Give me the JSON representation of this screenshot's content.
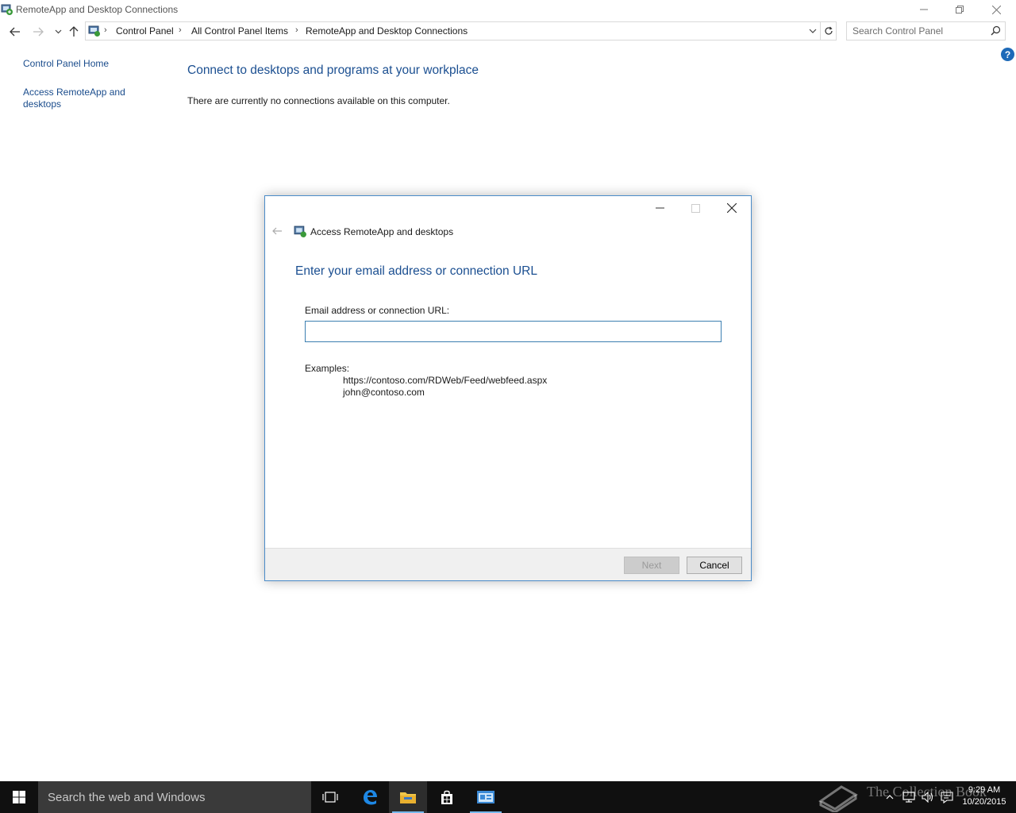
{
  "window": {
    "title": "RemoteApp and Desktop Connections"
  },
  "address": {
    "breadcrumbs": [
      "Control Panel",
      "All Control Panel Items",
      "RemoteApp and Desktop Connections"
    ],
    "search_placeholder": "Search Control Panel"
  },
  "sidebar": {
    "items": [
      {
        "label": "Control Panel Home"
      },
      {
        "label_line1": "Access RemoteApp and",
        "label_line2": "desktops"
      }
    ]
  },
  "main": {
    "title": "Connect to desktops and programs at your workplace",
    "status_text": "There are currently no connections available on this computer."
  },
  "help": {
    "glyph": "?"
  },
  "dialog": {
    "title": "Access RemoteApp and desktops",
    "heading": "Enter your email address or connection URL",
    "field_label": "Email address or connection URL:",
    "field_value": "",
    "examples_label": "Examples:",
    "examples": [
      "https://contoso.com/RDWeb/Feed/webfeed.aspx",
      "john@contoso.com"
    ],
    "next_label": "Next",
    "next_enabled": false,
    "cancel_label": "Cancel"
  },
  "taskbar": {
    "search_placeholder": "Search the web and Windows",
    "apps": [
      "task-view",
      "edge",
      "file-explorer",
      "store",
      "remoteapp-control-panel"
    ],
    "time": "9:29 AM",
    "date": "10/20/2015",
    "watermark": "The Collection Book"
  },
  "colors": {
    "accent_blue": "#1b4f91",
    "link_blue": "#1a4c8c",
    "taskbar": "#101010",
    "dialog_border": "#4a8bc8"
  }
}
